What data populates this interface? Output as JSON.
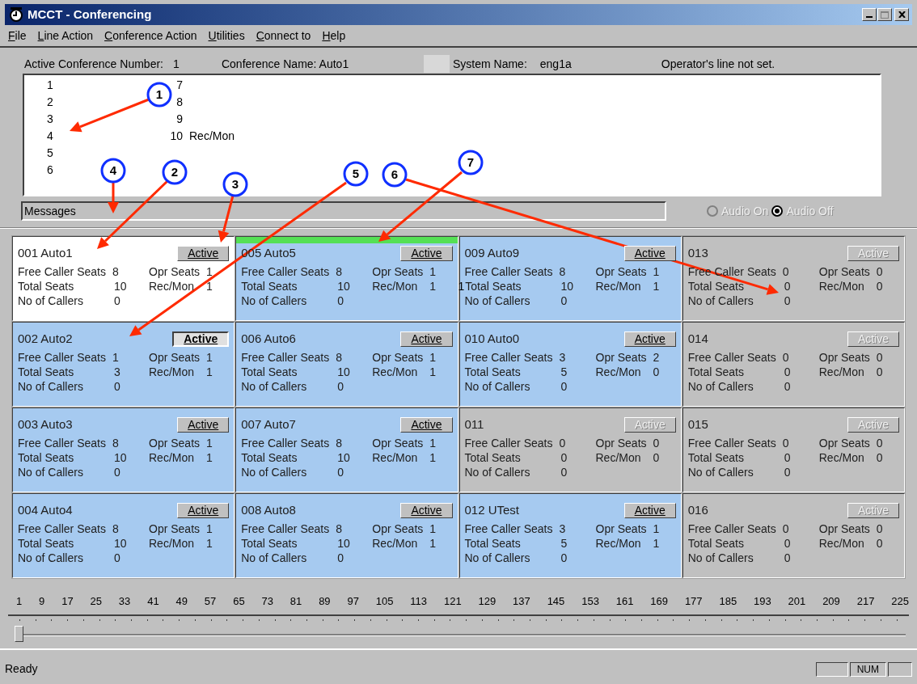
{
  "window": {
    "title": "MCCT - Conferencing"
  },
  "menu": [
    "File",
    "Line Action",
    "Conference Action",
    "Utilities",
    "Connect to",
    "Help"
  ],
  "info": {
    "active_label": "Active Conference Number:",
    "active_value": "1",
    "conference_name": "Conference Name: Auto1",
    "system_label": "System Name:",
    "system_value": "eng1a",
    "operator": "Operator's line not set."
  },
  "lines": [
    {
      "number": "1"
    },
    {
      "number": "2"
    },
    {
      "number": "3"
    },
    {
      "number": "4"
    },
    {
      "number": "5"
    },
    {
      "number": "6"
    },
    {
      "number": "7"
    },
    {
      "number": "8"
    },
    {
      "number": "9"
    },
    {
      "number": "10",
      "role": "Rec/Mon"
    }
  ],
  "messages": "Messages",
  "audio": [
    {
      "label": "Audio On",
      "selected": false,
      "disabled": true
    },
    {
      "label": "Audio Off",
      "selected": true,
      "disabled": true
    }
  ],
  "cards": [
    {
      "title": "001 Auto1",
      "kind": "selected",
      "button": "Active",
      "highlighted": false,
      "pressed": false,
      "free_label": "Free Caller Seats",
      "free": "8",
      "total_label": "Total Seats",
      "total": "10",
      "callers_label": "No of Callers",
      "callers": "0",
      "opr_label": "Opr Seats",
      "opr": "1",
      "recmon_label": "Rec/Mon",
      "recmon": "1"
    },
    {
      "title": "002 Auto2",
      "kind": "active",
      "button": "Active",
      "highlighted": false,
      "pressed": true,
      "free_label": "Free Caller Seats",
      "free": "1",
      "total_label": "Total Seats",
      "total": "3",
      "callers_label": "No of Callers",
      "callers": "0",
      "opr_label": "Opr Seats",
      "opr": "1",
      "recmon_label": "Rec/Mon",
      "recmon": "1"
    },
    {
      "title": "003 Auto3",
      "kind": "active",
      "button": "Active",
      "highlighted": false,
      "pressed": false,
      "free_label": "Free Caller Seats",
      "free": "8",
      "total_label": "Total Seats",
      "total": "10",
      "callers_label": "No of Callers",
      "callers": "0",
      "opr_label": "Opr Seats",
      "opr": "1",
      "recmon_label": "Rec/Mon",
      "recmon": "1"
    },
    {
      "title": "004 Auto4",
      "kind": "active",
      "button": "Active",
      "highlighted": false,
      "pressed": false,
      "free_label": "Free Caller Seats",
      "free": "8",
      "total_label": "Total Seats",
      "total": "10",
      "callers_label": "No of Callers",
      "callers": "0",
      "opr_label": "Opr Seats",
      "opr": "1",
      "recmon_label": "Rec/Mon",
      "recmon": "1"
    },
    {
      "title": "005 Auto5",
      "kind": "active",
      "button": "Active",
      "highlighted": true,
      "pressed": false,
      "free_label": "Free Caller Seats",
      "free": "8",
      "total_label": "Total Seats",
      "total": "10",
      "callers_label": "No of Callers",
      "callers": "0",
      "opr_label": "Opr Seats",
      "opr": "1",
      "recmon_label": "Rec/Mon",
      "recmon": "1"
    },
    {
      "title": "006 Auto6",
      "kind": "active",
      "button": "Active",
      "highlighted": false,
      "pressed": false,
      "free_label": "Free Caller Seats",
      "free": "8",
      "total_label": "Total Seats",
      "total": "10",
      "callers_label": "No of Callers",
      "callers": "0",
      "opr_label": "Opr Seats",
      "opr": "1",
      "recmon_label": "Rec/Mon",
      "recmon": "1"
    },
    {
      "title": "007 Auto7",
      "kind": "active",
      "button": "Active",
      "highlighted": false,
      "pressed": false,
      "free_label": "Free Caller Seats",
      "free": "8",
      "total_label": "Total Seats",
      "total": "10",
      "callers_label": "No of Callers",
      "callers": "0",
      "opr_label": "Opr Seats",
      "opr": "1",
      "recmon_label": "Rec/Mon",
      "recmon": "1"
    },
    {
      "title": "008 Auto8",
      "kind": "active",
      "button": "Active",
      "highlighted": false,
      "pressed": false,
      "free_label": "Free Caller Seats",
      "free": "8",
      "total_label": "Total Seats",
      "total": "10",
      "callers_label": "No of Callers",
      "callers": "0",
      "opr_label": "Opr Seats",
      "opr": "1",
      "recmon_label": "Rec/Mon",
      "recmon": "1"
    },
    {
      "title": "009 Auto9",
      "kind": "active",
      "button": "Active",
      "highlighted": false,
      "pressed": false,
      "free_label": "Free Caller Seats",
      "free": "8",
      "stray_mark": "1",
      "total_label": "Total Seats",
      "total": "10",
      "callers_label": "No of Callers",
      "callers": "0",
      "opr_label": "Opr Seats",
      "opr": "1",
      "recmon_label": "Rec/Mon",
      "recmon": "1"
    },
    {
      "title": "010 Auto0",
      "kind": "active",
      "button": "Active",
      "highlighted": false,
      "pressed": false,
      "free_label": "Free Caller Seats",
      "free": "3",
      "total_label": "Total Seats",
      "total": "5",
      "callers_label": "No of Callers",
      "callers": "0",
      "opr_label": "Opr Seats",
      "opr": "2",
      "recmon_label": "Rec/Mon",
      "recmon": "0"
    },
    {
      "title": "011",
      "kind": "empty",
      "button": "Active",
      "highlighted": false,
      "pressed": false,
      "free_label": "Free Caller Seats",
      "free": "0",
      "total_label": "Total Seats",
      "total": "0",
      "callers_label": "No of Callers",
      "callers": "0",
      "opr_label": "Opr Seats",
      "opr": "0",
      "recmon_label": "Rec/Mon",
      "recmon": "0"
    },
    {
      "title": "012 UTest",
      "kind": "active",
      "button": "Active",
      "highlighted": false,
      "pressed": false,
      "free_label": "Free Caller Seats",
      "free": "3",
      "total_label": "Total Seats",
      "total": "5",
      "callers_label": "No of Callers",
      "callers": "0",
      "opr_label": "Opr Seats",
      "opr": "1",
      "recmon_label": "Rec/Mon",
      "recmon": "1"
    },
    {
      "title": "013",
      "kind": "empty",
      "button": "Active",
      "highlighted": false,
      "pressed": false,
      "free_label": "Free Caller Seats",
      "free": "0",
      "total_label": "Total Seats",
      "total": "0",
      "callers_label": "No of Callers",
      "callers": "0",
      "opr_label": "Opr Seats",
      "opr": "0",
      "recmon_label": "Rec/Mon",
      "recmon": "0"
    },
    {
      "title": "014",
      "kind": "empty",
      "button": "Active",
      "highlighted": false,
      "pressed": false,
      "free_label": "Free Caller Seats",
      "free": "0",
      "total_label": "Total Seats",
      "total": "0",
      "callers_label": "No of Callers",
      "callers": "0",
      "opr_label": "Opr Seats",
      "opr": "0",
      "recmon_label": "Rec/Mon",
      "recmon": "0"
    },
    {
      "title": "015",
      "kind": "empty",
      "button": "Active",
      "highlighted": false,
      "pressed": false,
      "free_label": "Free Caller Seats",
      "free": "0",
      "total_label": "Total Seats",
      "total": "0",
      "callers_label": "No of Callers",
      "callers": "0",
      "opr_label": "Opr Seats",
      "opr": "0",
      "recmon_label": "Rec/Mon",
      "recmon": "0"
    },
    {
      "title": "016",
      "kind": "empty",
      "button": "Active",
      "highlighted": false,
      "pressed": false,
      "free_label": "Free Caller Seats",
      "free": "0",
      "total_label": "Total Seats",
      "total": "0",
      "callers_label": "No of Callers",
      "callers": "0",
      "opr_label": "Opr Seats",
      "opr": "0",
      "recmon_label": "Rec/Mon",
      "recmon": "0"
    }
  ],
  "scale": [
    "1",
    "9",
    "17",
    "25",
    "33",
    "41",
    "49",
    "57",
    "65",
    "73",
    "81",
    "89",
    "97",
    "105",
    "113",
    "121",
    "129",
    "137",
    "145",
    "153",
    "161",
    "169",
    "177",
    "185",
    "193",
    "201",
    "209",
    "217",
    "225"
  ],
  "slider": {
    "level": 0
  },
  "status_bar": {
    "text": "Ready",
    "indicators": [
      "NUM"
    ]
  },
  "callouts": [
    {
      "label": "1"
    },
    {
      "label": "2"
    },
    {
      "label": "3"
    },
    {
      "label": "4"
    },
    {
      "label": "5"
    },
    {
      "label": "6"
    },
    {
      "label": "7"
    }
  ]
}
